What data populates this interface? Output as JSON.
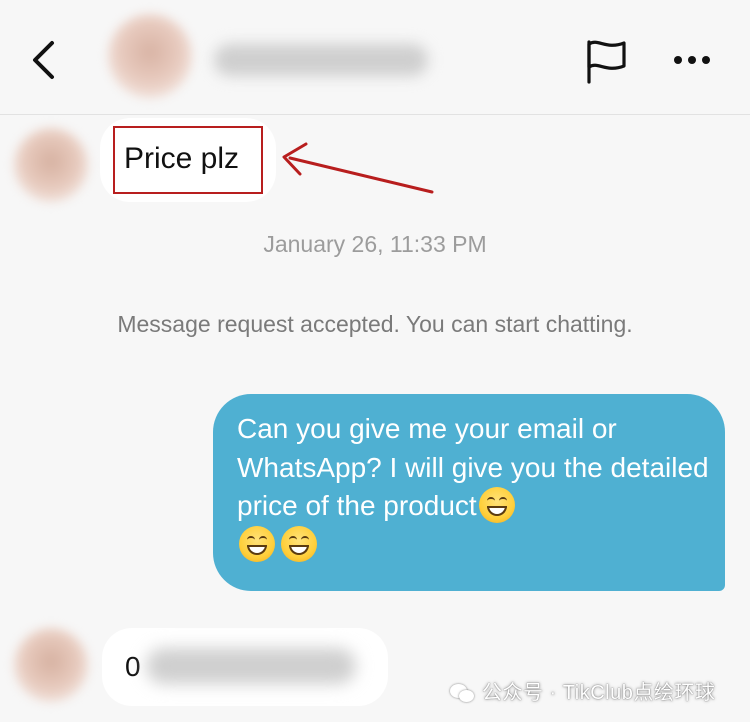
{
  "header": {
    "back_icon": "chevron-left-icon",
    "flag_icon": "flag-icon",
    "more_icon": "ellipsis-icon"
  },
  "messages": {
    "first_incoming": "Price plz",
    "timestamp": "January 26, 11:33 PM",
    "system_notice": "Message request accepted. You can start chatting.",
    "outgoing_text": "Can you give me your email or WhatsApp? I will give you the detailed price of the product",
    "outgoing_emoji": "😁",
    "last_incoming_visible": "0"
  },
  "annotation": {
    "highlight_color": "#b81e1e"
  },
  "watermark": {
    "text": "公众号 · TikClub点绘环球"
  },
  "colors": {
    "background": "#f7f7f7",
    "outgoing_bubble": "#4fb0d2",
    "incoming_bubble": "#ffffff"
  }
}
